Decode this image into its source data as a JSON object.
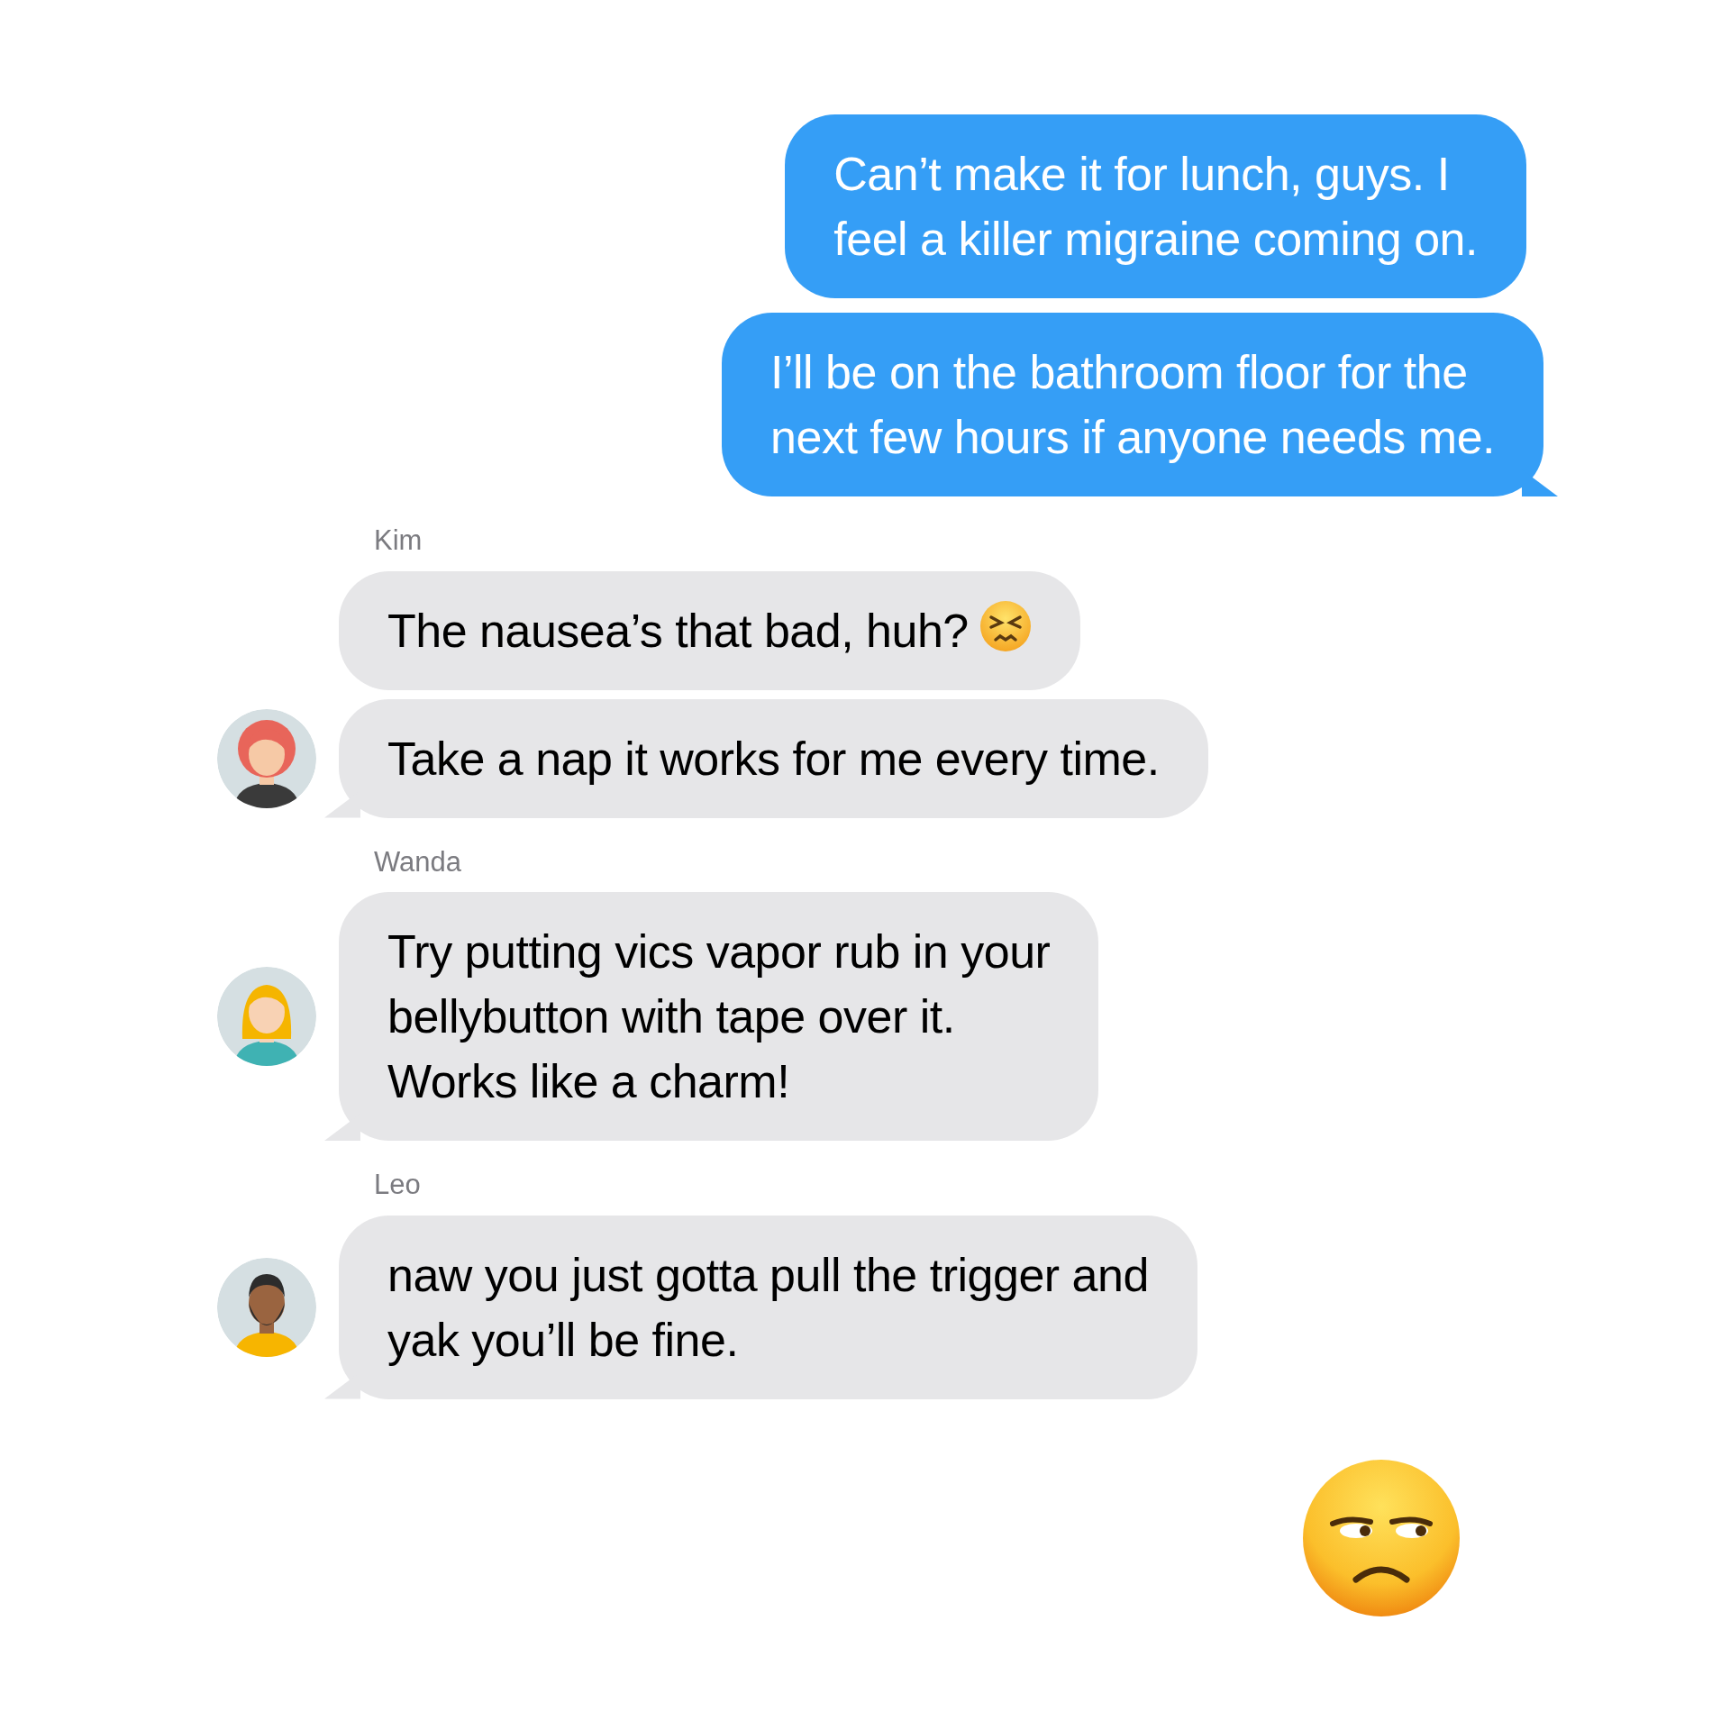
{
  "conversation": [
    {
      "kind": "outgoing",
      "messages": [
        {
          "text": "Can’t make it for lunch, guys. I\nfeel a killer migraine coming on.",
          "trailing_icon": false
        },
        {
          "text": "I’ll be on the bathroom floor for the\nnext few hours if anyone needs me.",
          "trailing_icon": false
        }
      ]
    },
    {
      "kind": "incoming",
      "sender": "Kim",
      "messages": [
        {
          "text": "The nausea’s that bad, huh?",
          "trailing_icon": true
        },
        {
          "text": "Take a nap it works for me every time.",
          "trailing_icon": false
        }
      ]
    },
    {
      "kind": "incoming",
      "sender": "Wanda",
      "messages": [
        {
          "text": "Try putting vics vapor rub in your\nbellybutton with tape over it.\nWorks like a charm!",
          "trailing_icon": false
        }
      ]
    },
    {
      "kind": "incoming",
      "sender": "Leo",
      "messages": [
        {
          "text": "naw you just gotta pull the trigger and\nyak you’ll be fine.",
          "trailing_icon": false
        }
      ]
    },
    {
      "kind": "emoji"
    }
  ]
}
